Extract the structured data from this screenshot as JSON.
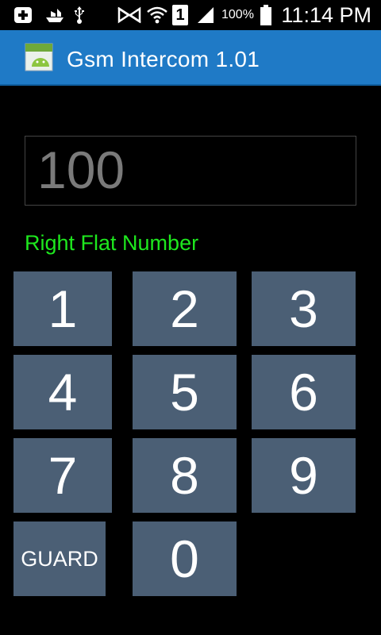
{
  "status_bar": {
    "icons": [
      "add-icon",
      "ship-icon",
      "usb-icon",
      "mute-icon",
      "wifi-icon",
      "sim-1-icon",
      "signal-icon",
      "battery-icon"
    ],
    "sim_label": "1",
    "battery_percent": "100%",
    "time": "11:14 PM"
  },
  "action_bar": {
    "title": "Gsm Intercom 1.01",
    "app_icon_label": "Android",
    "color": "#1f7ac6"
  },
  "display": {
    "value": "100"
  },
  "hint": {
    "text": "Right Flat Number",
    "color": "#1ee81e"
  },
  "keypad": {
    "key_color": "#4b5f75",
    "keys": [
      "1",
      "2",
      "3",
      "4",
      "5",
      "6",
      "7",
      "8",
      "9",
      "GUARD",
      "0"
    ]
  }
}
